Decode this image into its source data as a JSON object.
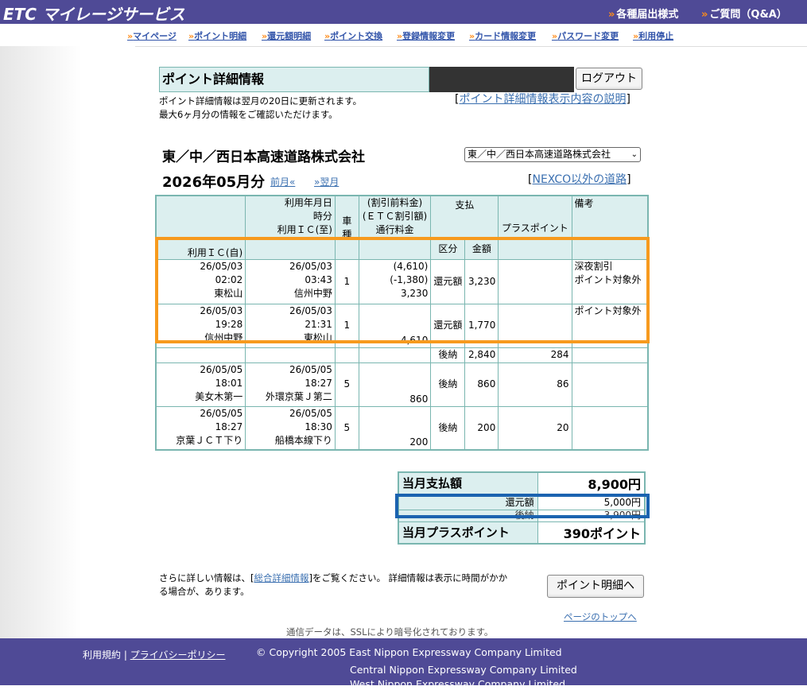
{
  "header": {
    "logo": "ETC マイレージサービス",
    "links": [
      "各種届出様式",
      "ご質問（Q&A）"
    ]
  },
  "nav": {
    "items": [
      "マイページ",
      "ポイント明細",
      "還元額明細",
      "ポイント交換",
      "登録情報変更",
      "カード情報変更",
      "パスワード変更",
      "利用停止"
    ]
  },
  "page": {
    "title": "ポイント詳細情報",
    "logout": "ログアウト",
    "note_line1": "ポイント詳細情報は翌月の20日に更新されます。",
    "note_line2": "最大6ヶ月分の情報をご確認いただけます。",
    "explain_link": "ポイント詳細情報表示内容の説明",
    "company": "東／中／西日本高速道路株式会社",
    "company_select": "東／中／西日本高速道路株式会社",
    "month": "2026年05月分",
    "prev": "前月«",
    "next": "»翌月",
    "other_roads": "NEXCO以外の道路"
  },
  "table": {
    "headers": {
      "ic_from": "利用ＩＣ(自)",
      "date_line1": "利用年月日",
      "date_line2": "時分",
      "ic_to": "利用ＩＣ(至)",
      "car_type": "車種",
      "fee_line1": "(割引前料金)",
      "fee_line2": "(ＥＴＣ割引額)",
      "fee_line3": "通行料金",
      "payment": "支払",
      "pay_kind": "区分",
      "pay_amount": "金額",
      "plus_point": "プラスポイント",
      "remarks": "備考"
    },
    "rows": [
      {
        "from_date": "26/05/03",
        "from_time": "02:02",
        "from_ic": "東松山",
        "to_date": "26/05/03",
        "to_time": "03:43",
        "to_ic": "信州中野",
        "car": "1",
        "fee1": "(4,610)",
        "fee2": "(-1,380)",
        "fee3": "3,230",
        "kind": "還元額",
        "amount": "3,230",
        "point": "",
        "remark1": "深夜割引",
        "remark2": "ポイント対象外"
      },
      {
        "from_date": "26/05/03",
        "from_time": "19:28",
        "from_ic": "信州中野",
        "to_date": "26/05/03",
        "to_time": "21:31",
        "to_ic": "東松山",
        "car": "1",
        "fee1": "",
        "fee2": "",
        "fee3": "4,610",
        "kind": "還元額",
        "amount": "1,770",
        "point": "",
        "remark1": "ポイント対象外",
        "remark2": ""
      },
      {
        "kind": "後納",
        "amount": "2,840",
        "point": "284"
      },
      {
        "from_date": "26/05/05",
        "from_time": "18:01",
        "from_ic": "美女木第一",
        "to_date": "26/05/05",
        "to_time": "18:27",
        "to_ic": "外環京葉Ｊ第二",
        "car": "5",
        "fee1": "",
        "fee2": "",
        "fee3": "860",
        "kind": "後納",
        "amount": "860",
        "point": "86",
        "remark1": "",
        "remark2": ""
      },
      {
        "from_date": "26/05/05",
        "from_time": "18:27",
        "from_ic": "京葉ＪＣＴ下り",
        "to_date": "26/05/05",
        "to_time": "18:30",
        "to_ic": "船橋本線下り",
        "car": "5",
        "fee1": "",
        "fee2": "",
        "fee3": "200",
        "kind": "後納",
        "amount": "200",
        "point": "20",
        "remark1": "",
        "remark2": ""
      }
    ]
  },
  "summary": {
    "total_label": "当月支払額",
    "total_value": "8,900円",
    "refund_label": "還元額",
    "refund_value": "5,000円",
    "deferred_label": "後納",
    "deferred_value": "3,900円",
    "points_label": "当月プラスポイント",
    "points_value": "390ポイント"
  },
  "bottom": {
    "more_prefix": "さらに詳しい情報は、[",
    "more_link": "総合詳細情報",
    "more_suffix": "]をご覧ください。 詳細情報は表示に時間がかか",
    "more_line2": "る場合が、あります。",
    "point_button": "ポイント明細へ",
    "top_link": "ページのトップへ",
    "ssl_note": "通信データは、SSLにより暗号化されております。"
  },
  "footer": {
    "terms": "利用規約",
    "privacy": "プライバシーポリシー",
    "copyright1": "© Copyright 2005 East Nippon Expressway Company Limited",
    "copyright2": "Central Nippon Expressway Company Limited",
    "copyright3": "West Nippon Expressway Company Limited"
  },
  "colors": {
    "header_bg": "#4f4a96",
    "table_head": "#dcefef",
    "table_border": "#7ab6b0",
    "highlight_orange": "#f79a1e",
    "highlight_blue": "#1b63b0"
  }
}
